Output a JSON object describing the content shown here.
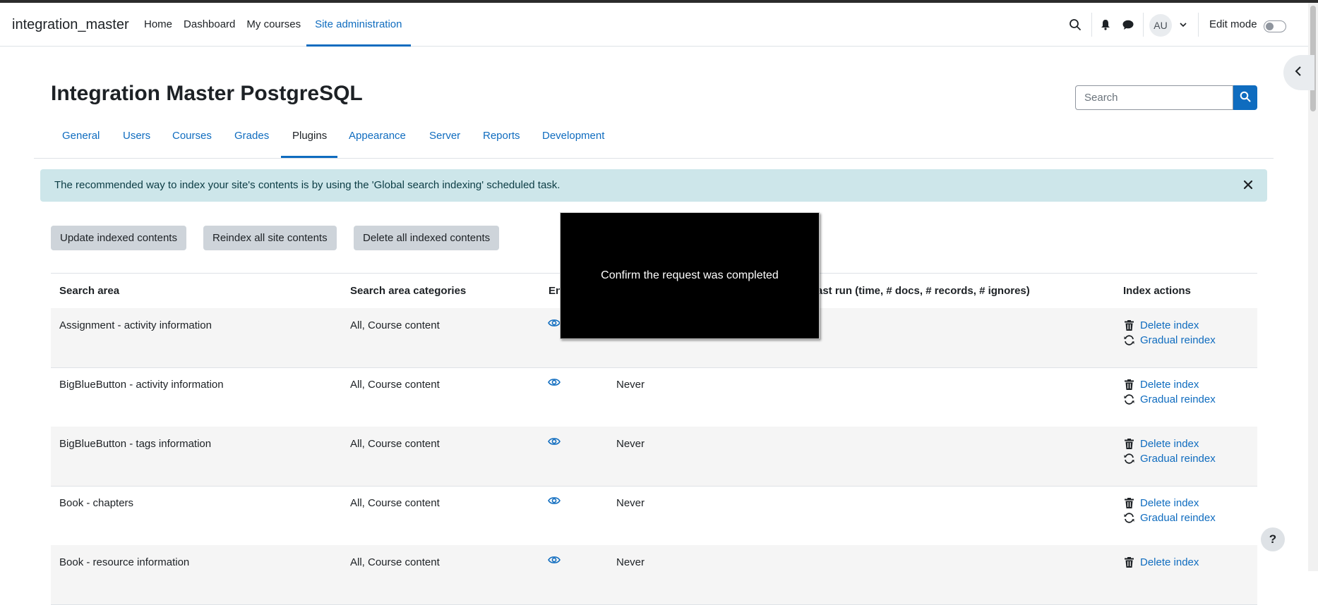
{
  "navbar": {
    "brand": "integration_master",
    "items": [
      {
        "label": "Home"
      },
      {
        "label": "Dashboard"
      },
      {
        "label": "My courses"
      },
      {
        "label": "Site administration",
        "active": true
      }
    ],
    "user_initials": "AU",
    "edit_mode_label": "Edit mode",
    "edit_mode_on": false
  },
  "page": {
    "title": "Integration Master PostgreSQL",
    "search_placeholder": "Search"
  },
  "tabs": [
    {
      "label": "General"
    },
    {
      "label": "Users"
    },
    {
      "label": "Courses"
    },
    {
      "label": "Grades"
    },
    {
      "label": "Plugins",
      "active": true
    },
    {
      "label": "Appearance"
    },
    {
      "label": "Server"
    },
    {
      "label": "Reports"
    },
    {
      "label": "Development"
    }
  ],
  "alert": {
    "text": "The recommended way to index your site's contents is by using the 'Global search indexing' scheduled task."
  },
  "buttons": {
    "update": "Update indexed contents",
    "reindex": "Reindex all site contents",
    "delete_all": "Delete all indexed contents"
  },
  "table": {
    "headers": {
      "area": "Search area",
      "categories": "Search area categories",
      "enabled": "En",
      "lastrun": "ast run (time, # docs, # records, # ignores)",
      "actions": "Index actions"
    },
    "rows": [
      {
        "area": "Assignment - activity information",
        "categories": "All, Course content",
        "last": "",
        "delete": "Delete index",
        "reindex": "Gradual reindex"
      },
      {
        "area": "BigBlueButton - activity information",
        "categories": "All, Course content",
        "last": "Never",
        "delete": "Delete index",
        "reindex": "Gradual reindex"
      },
      {
        "area": "BigBlueButton - tags information",
        "categories": "All, Course content",
        "last": "Never",
        "delete": "Delete index",
        "reindex": "Gradual reindex"
      },
      {
        "area": "Book - chapters",
        "categories": "All, Course content",
        "last": "Never",
        "delete": "Delete index",
        "reindex": "Gradual reindex"
      },
      {
        "area": "Book - resource information",
        "categories": "All, Course content",
        "last": "Never",
        "delete": "Delete index",
        "reindex": ""
      }
    ]
  },
  "modal": {
    "text": "Confirm the request was completed"
  },
  "help_label": "?"
}
